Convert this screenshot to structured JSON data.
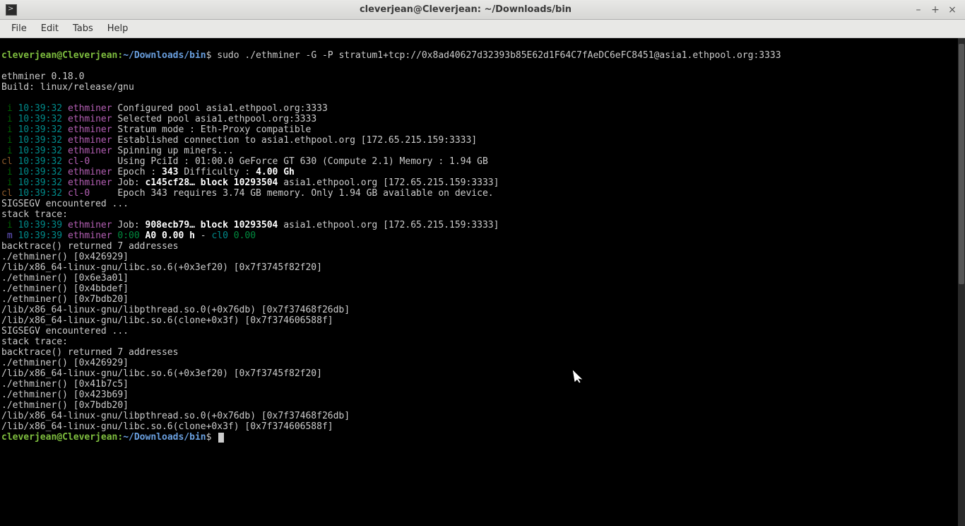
{
  "window": {
    "title": "cleverjean@Cleverjean: ~/Downloads/bin"
  },
  "menu": {
    "file": "File",
    "edit": "Edit",
    "tabs": "Tabs",
    "help": "Help"
  },
  "prompt": {
    "user": "cleverjean@Cleverjean",
    "sep": ":",
    "path": "~/Downloads/bin",
    "dollar": "$"
  },
  "command": "sudo ./ethminer -G -P stratum1+tcp://0x8ad40627d32393b85E62d1F64C7fAeDC6eFC8451@asia1.ethpool.org:3333",
  "header": {
    "l1": "ethminer 0.18.0",
    "l2": "Build: linux/release/gnu"
  },
  "log": [
    {
      "tag": "i",
      "ts": "10:39:32",
      "mod": "ethminer",
      "msg": "Configured pool asia1.ethpool.org:3333"
    },
    {
      "tag": "i",
      "ts": "10:39:32",
      "mod": "ethminer",
      "msg": "Selected pool asia1.ethpool.org:3333"
    },
    {
      "tag": "i",
      "ts": "10:39:32",
      "mod": "ethminer",
      "msg": "Stratum mode : Eth-Proxy compatible"
    },
    {
      "tag": "i",
      "ts": "10:39:32",
      "mod": "ethminer",
      "msg": "Established connection to asia1.ethpool.org [172.65.215.159:3333]"
    },
    {
      "tag": "i",
      "ts": "10:39:32",
      "mod": "ethminer",
      "msg": "Spinning up miners..."
    },
    {
      "tag": "cl",
      "ts": "10:39:32",
      "mod": "cl-0",
      "msg": "Using PciId : 01:00.0 GeForce GT 630 (Compute 2.1) Memory : 1.94 GB"
    },
    {
      "tag": "i",
      "ts": "10:39:32",
      "mod": "ethminer",
      "msg_pre": "Epoch : ",
      "msg_bold": "343",
      "msg_mid": " Difficulty : ",
      "msg_bold2": "4.00 Gh"
    },
    {
      "tag": "i",
      "ts": "10:39:32",
      "mod": "ethminer",
      "msg_pre": "Job: ",
      "msg_bold": "c145cf28… block 10293504",
      "msg_post": " asia1.ethpool.org [172.65.215.159:3333]"
    },
    {
      "tag": "cl",
      "ts": "10:39:32",
      "mod": "cl-0",
      "msg": "Epoch 343 requires 3.74 GB memory. Only 1.94 GB available on device."
    }
  ],
  "plain": {
    "sigsegv": "SIGSEGV encountered ...",
    "stacktrace": "stack trace:"
  },
  "log2": [
    {
      "tag": "i",
      "ts": "10:39:39",
      "mod": "ethminer",
      "msg_pre": "Job: ",
      "msg_bold": "908ecb79… block 10293504",
      "msg_post": " asia1.ethpool.org [172.65.215.159:3333]"
    }
  ],
  "stat": {
    "tag": "m",
    "ts": "10:39:39",
    "mod": "ethminer",
    "t1": "0:00",
    "a0": "A0",
    "rate": "0.00 h",
    "dash": " - ",
    "cl": "cl0",
    "clv": "0.00"
  },
  "trace1": [
    "backtrace() returned 7 addresses",
    "./ethminer() [0x426929]",
    "/lib/x86_64-linux-gnu/libc.so.6(+0x3ef20) [0x7f3745f82f20]",
    "./ethminer() [0x6e3a01]",
    "./ethminer() [0x4bbdef]",
    "./ethminer() [0x7bdb20]",
    "/lib/x86_64-linux-gnu/libpthread.so.0(+0x76db) [0x7f37468f26db]",
    "/lib/x86_64-linux-gnu/libc.so.6(clone+0x3f) [0x7f374606588f]",
    "SIGSEGV encountered ...",
    "stack trace:",
    "backtrace() returned 7 addresses",
    "./ethminer() [0x426929]",
    "/lib/x86_64-linux-gnu/libc.so.6(+0x3ef20) [0x7f3745f82f20]",
    "./ethminer() [0x41b7c5]",
    "./ethminer() [0x423b69]",
    "./ethminer() [0x7bdb20]",
    "/lib/x86_64-linux-gnu/libpthread.so.0(+0x76db) [0x7f37468f26db]",
    "/lib/x86_64-linux-gnu/libc.so.6(clone+0x3f) [0x7f374606588f]"
  ]
}
